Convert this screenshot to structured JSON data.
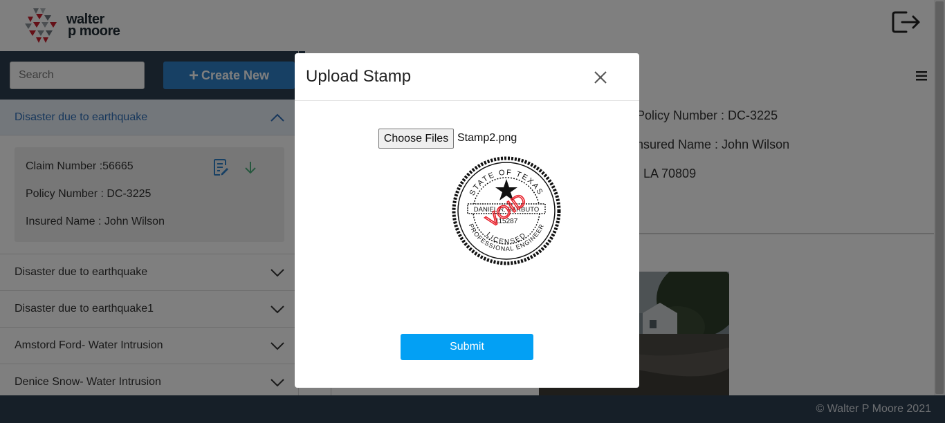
{
  "header": {
    "logo_line1": "walter",
    "logo_line2": "p moore"
  },
  "sidebar": {
    "search_placeholder": "Search",
    "create_label": "Create New",
    "active_item": {
      "title": "Disaster due to earthquake",
      "claim_number": "Claim Number :56665",
      "policy_number": "Policy Number : DC-3225",
      "insured_name": "Insured Name : John Wilson"
    },
    "items": [
      {
        "title": "Disaster due to earthquake"
      },
      {
        "title": "Disaster due to earthquake1"
      },
      {
        "title": "Amstord Ford- Water Intrusion"
      },
      {
        "title": "Denice Snow- Water Intrusion"
      }
    ]
  },
  "main": {
    "policy_number": "Policy Number : DC-3225",
    "insured_name": "nsured Name : John Wilson",
    "address_tail": ", LA 70809"
  },
  "footer": {
    "copyright": "© Walter P Moore 2021"
  },
  "modal": {
    "title": "Upload Stamp",
    "choose_label": "Choose Files",
    "file_name": "Stamp2.png",
    "submit_label": "Submit",
    "stamp": {
      "ring_text": "STATE OF TEXAS",
      "bottom_text": "PROFESSIONAL ENGINEER",
      "licensed": "LICENSED",
      "name": "DANIEL R. BARBUTO",
      "number": "115287",
      "overlay_text": "VOID"
    }
  },
  "colors": {
    "nav_dark": "#2c3e50",
    "primary_blue": "#2f80c8",
    "submit_blue": "#03a0f4",
    "logo_red": "#c8202f",
    "logo_gray": "#8a9299",
    "void_red": "#e8202a"
  }
}
